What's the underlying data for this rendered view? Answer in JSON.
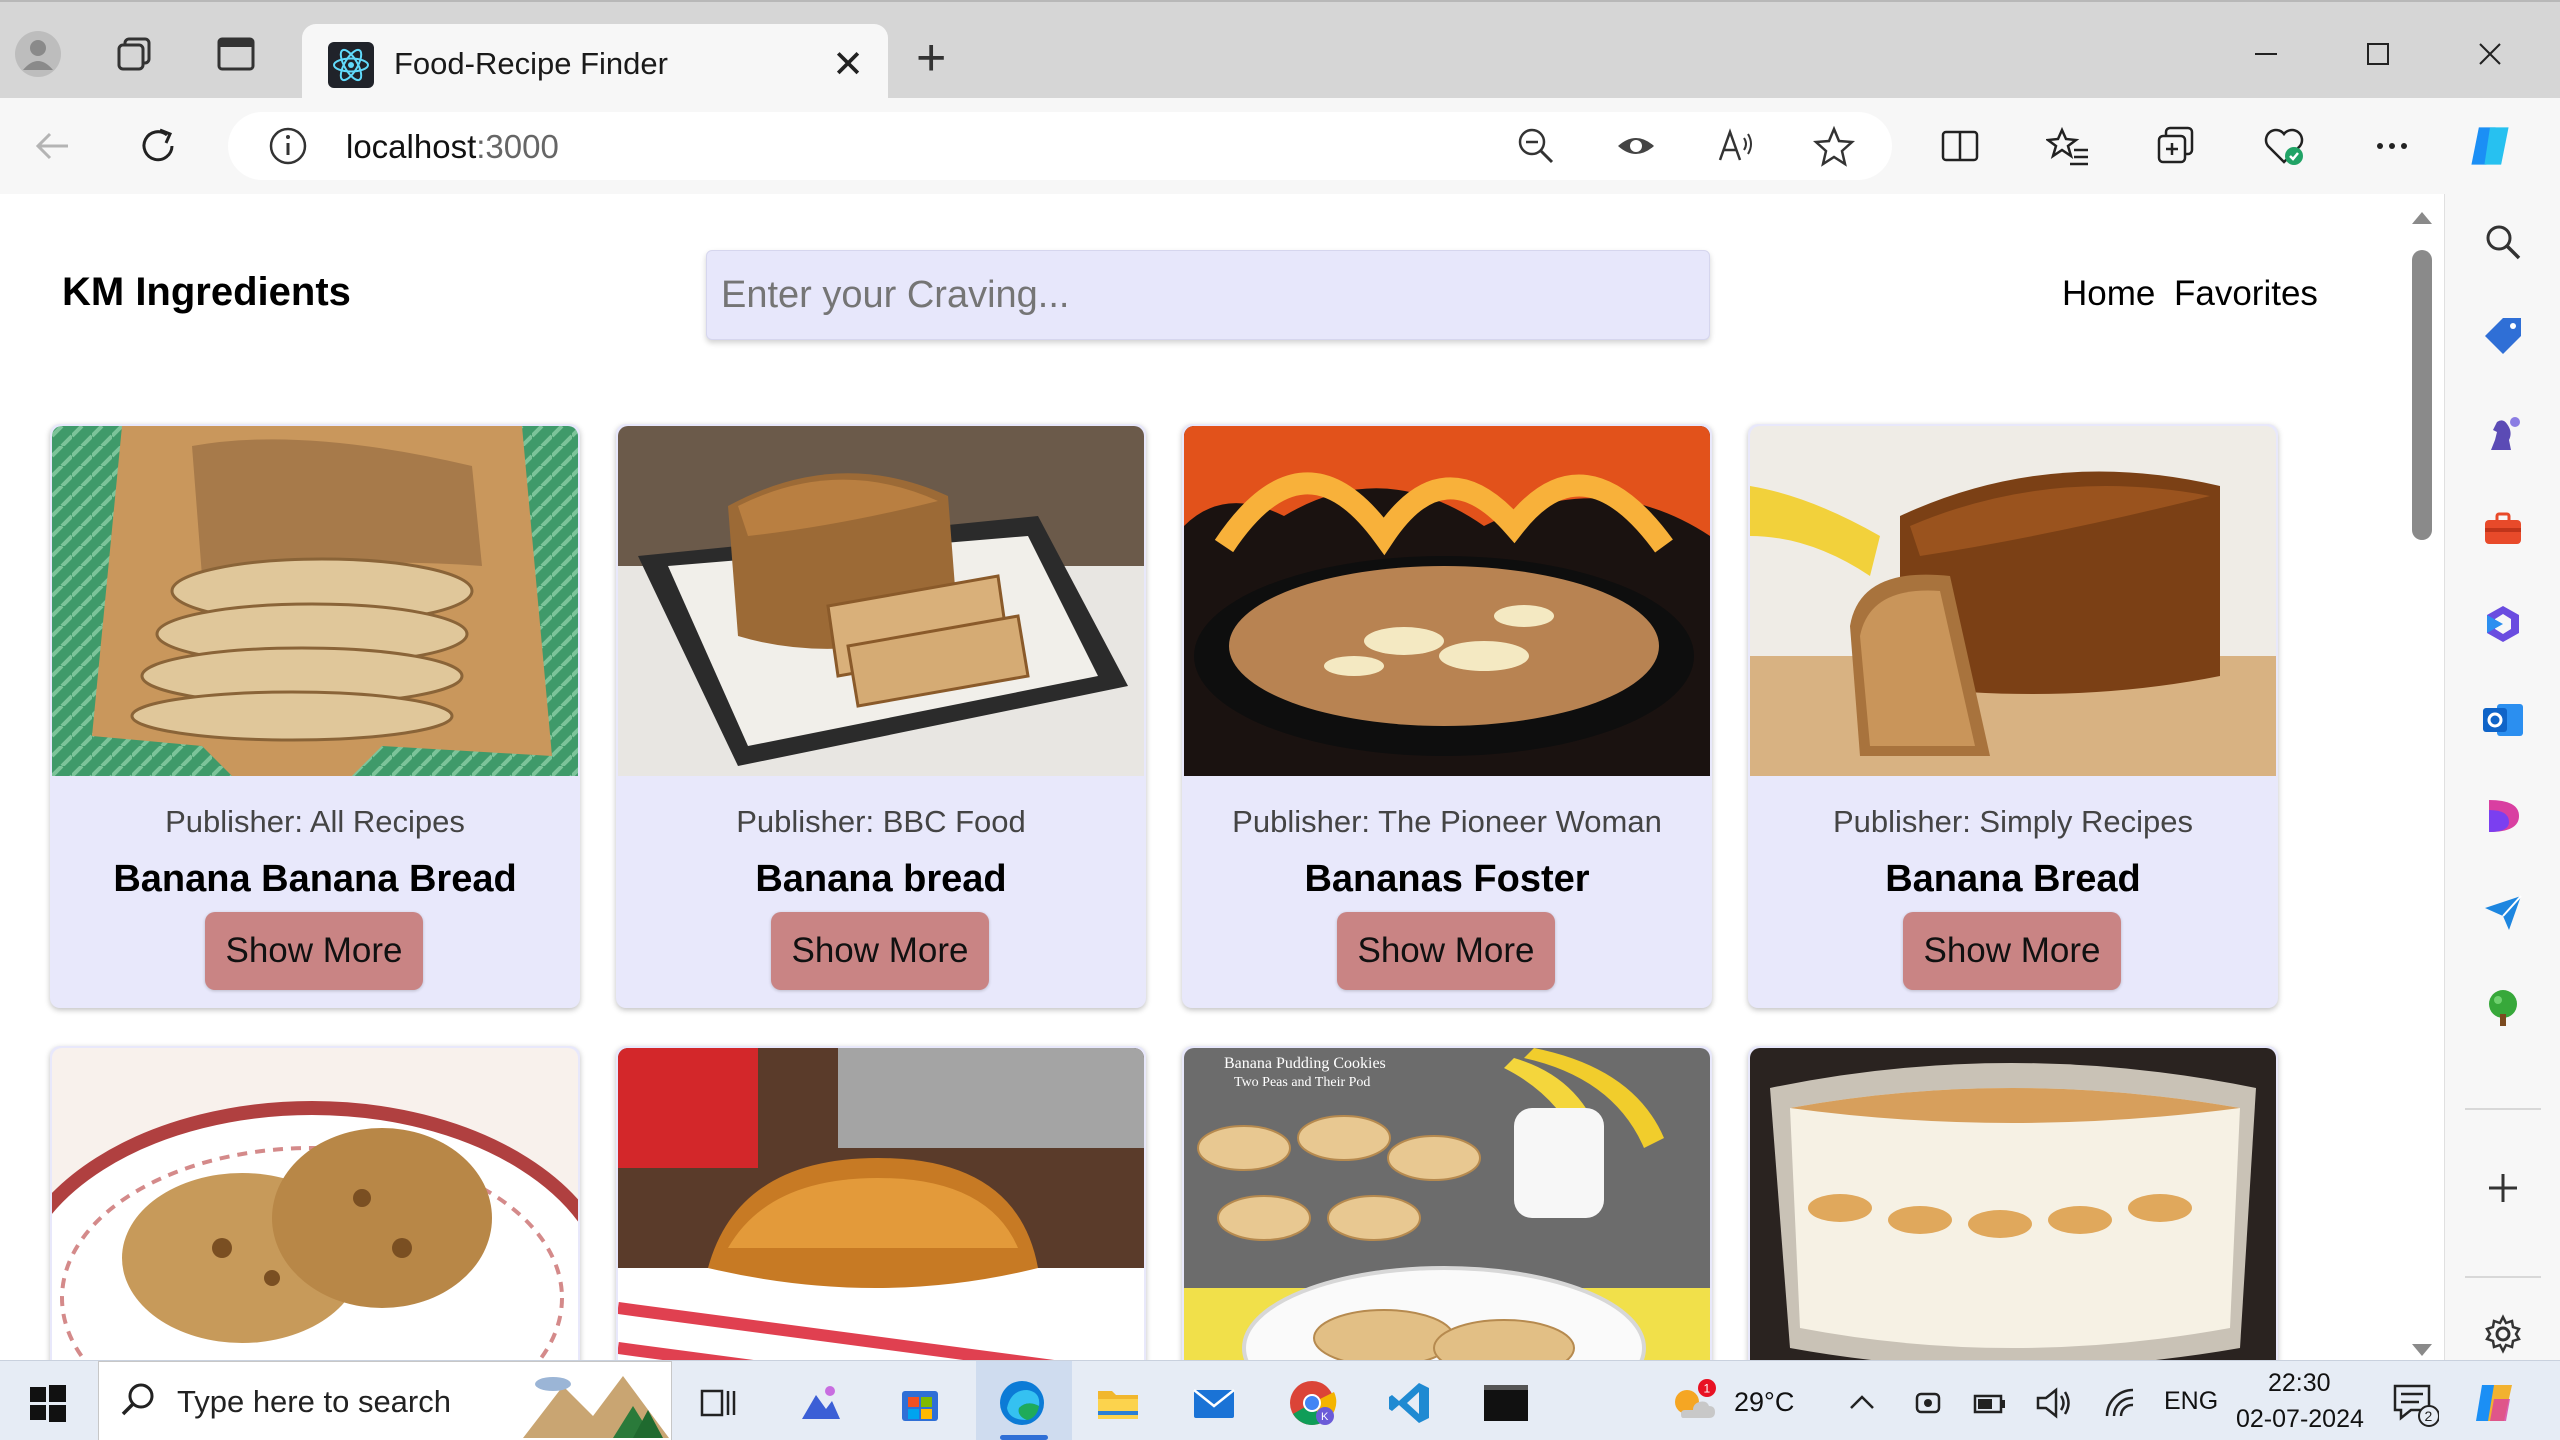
{
  "browser": {
    "tab_title": "Food-Recipe Finder",
    "url_host": "localhost",
    "url_port": ":3000"
  },
  "app": {
    "brand": "KM Ingredients",
    "search_placeholder": "Enter your Craving...",
    "nav": {
      "home": "Home",
      "favorites": "Favorites"
    }
  },
  "recipes": [
    {
      "publisher": "Publisher: All Recipes",
      "title": "Banana Banana Bread",
      "button": "Show More"
    },
    {
      "publisher": "Publisher: BBC Food",
      "title": "Banana bread",
      "button": "Show More"
    },
    {
      "publisher": "Publisher: The Pioneer Woman",
      "title": "Bananas Foster",
      "button": "Show More"
    },
    {
      "publisher": "Publisher: Simply Recipes",
      "title": "Banana Bread",
      "button": "Show More"
    }
  ],
  "recipe_row2_image_captions": [
    "Banana Pudding Cookies",
    "Two Peas and Their Pod"
  ],
  "taskbar": {
    "search_placeholder": "Type here to search",
    "weather": "29°C",
    "weather_badge": "1",
    "language": "ENG",
    "time": "22:30",
    "date": "02-07-2024",
    "notification_count": "2"
  },
  "colors": {
    "card_bg": "#e8e8fb",
    "button_bg": "#c98484",
    "search_bg": "#e7e7fb"
  }
}
